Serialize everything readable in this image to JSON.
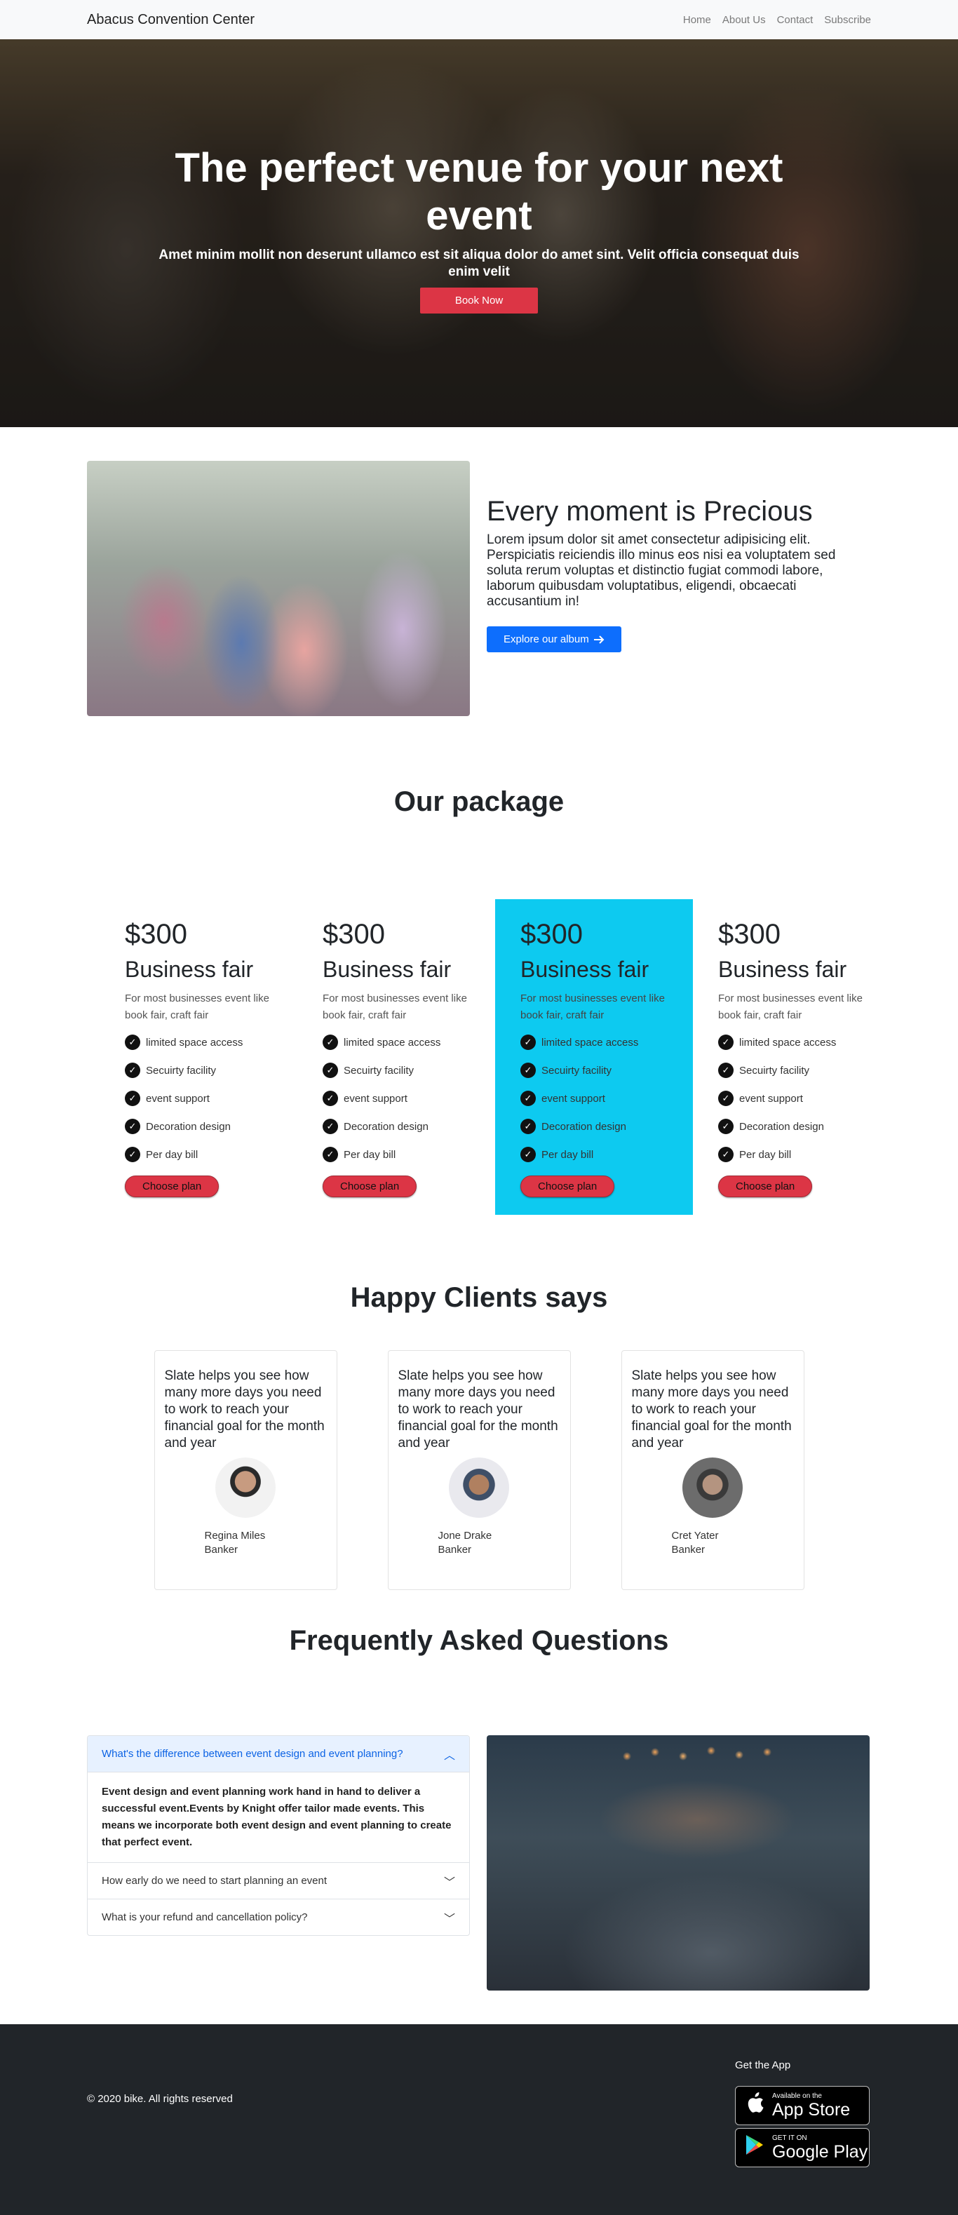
{
  "navbar": {
    "brand": "Abacus Convention Center",
    "links": [
      "Home",
      "About Us",
      "Contact",
      "Subscribe"
    ]
  },
  "hero": {
    "title": "The perfect venue for your next event",
    "subtitle": "Amet minim mollit non deserunt ullamco est sit aliqua dolor do amet sint. Velit officia consequat duis enim velit",
    "button": "Book Now"
  },
  "about": {
    "title": "Every moment is Precious",
    "body": "Lorem ipsum dolor sit amet consectetur adipisicing elit. Perspiciatis reiciendis illo minus eos nisi ea voluptatem sed soluta rerum voluptas et distinctio fugiat commodi labore, laborum quibusdam voluptatibus, eligendi, obcaecati accusantium in!",
    "button": "Explore our album",
    "button_icon": "arrow-right-icon"
  },
  "packages": {
    "title": "Our package",
    "plans": [
      {
        "price": "$300",
        "name": "Business fair",
        "desc": "For most businesses event like book fair, craft fair",
        "features": [
          "limited space access",
          "Secuirty facility",
          "event support",
          "Decoration design",
          "Per day bill"
        ],
        "button": "Choose plan",
        "featured": false
      },
      {
        "price": "$300",
        "name": "Business fair",
        "desc": "For most businesses event like book fair, craft fair",
        "features": [
          "limited space access",
          "Secuirty facility",
          "event support",
          "Decoration design",
          "Per day bill"
        ],
        "button": "Choose plan",
        "featured": false
      },
      {
        "price": "$300",
        "name": "Business fair",
        "desc": "For most businesses event like book fair, craft fair",
        "features": [
          "limited space access",
          "Secuirty facility",
          "event support",
          "Decoration design",
          "Per day bill"
        ],
        "button": "Choose plan",
        "featured": true
      },
      {
        "price": "$300",
        "name": "Business fair",
        "desc": "For most businesses event like book fair, craft fair",
        "features": [
          "limited space access",
          "Secuirty facility",
          "event support",
          "Decoration design",
          "Per day bill"
        ],
        "button": "Choose plan",
        "featured": false
      }
    ],
    "featured_color": "#0dcaf0"
  },
  "clients": {
    "title": "Happy Clients says",
    "items": [
      {
        "quote": "Slate helps you see how many more days you need to work to reach your financial goal for the month and year",
        "name": "Regina Miles",
        "role": "Banker"
      },
      {
        "quote": "Slate helps you see how many more days you need to work to reach your financial goal for the month and year",
        "name": "Jone Drake",
        "role": "Banker"
      },
      {
        "quote": "Slate helps you see how many more days you need to work to reach your financial goal for the month and year",
        "name": "Cret Yater",
        "role": "Banker"
      }
    ]
  },
  "faq": {
    "title": "Frequently Asked Questions",
    "items": [
      {
        "question": "What's the difference between event design and event planning?",
        "answer": "Event design and event planning work hand in hand to deliver a successful event.Events by Knight offer tailor made events. This means we incorporate both event design and event planning to create that perfect event.",
        "open": true
      },
      {
        "question": "How early do we need to start planning an event",
        "open": false
      },
      {
        "question": "What is your refund and cancellation policy?",
        "open": false
      }
    ]
  },
  "footer": {
    "copyright": "© 2020 bike. All rights reserved",
    "get_app": "Get the App",
    "app_store": {
      "small": "Available on the",
      "big": "App Store"
    },
    "google_play": {
      "small": "GET IT ON",
      "big": "Google Play"
    }
  }
}
